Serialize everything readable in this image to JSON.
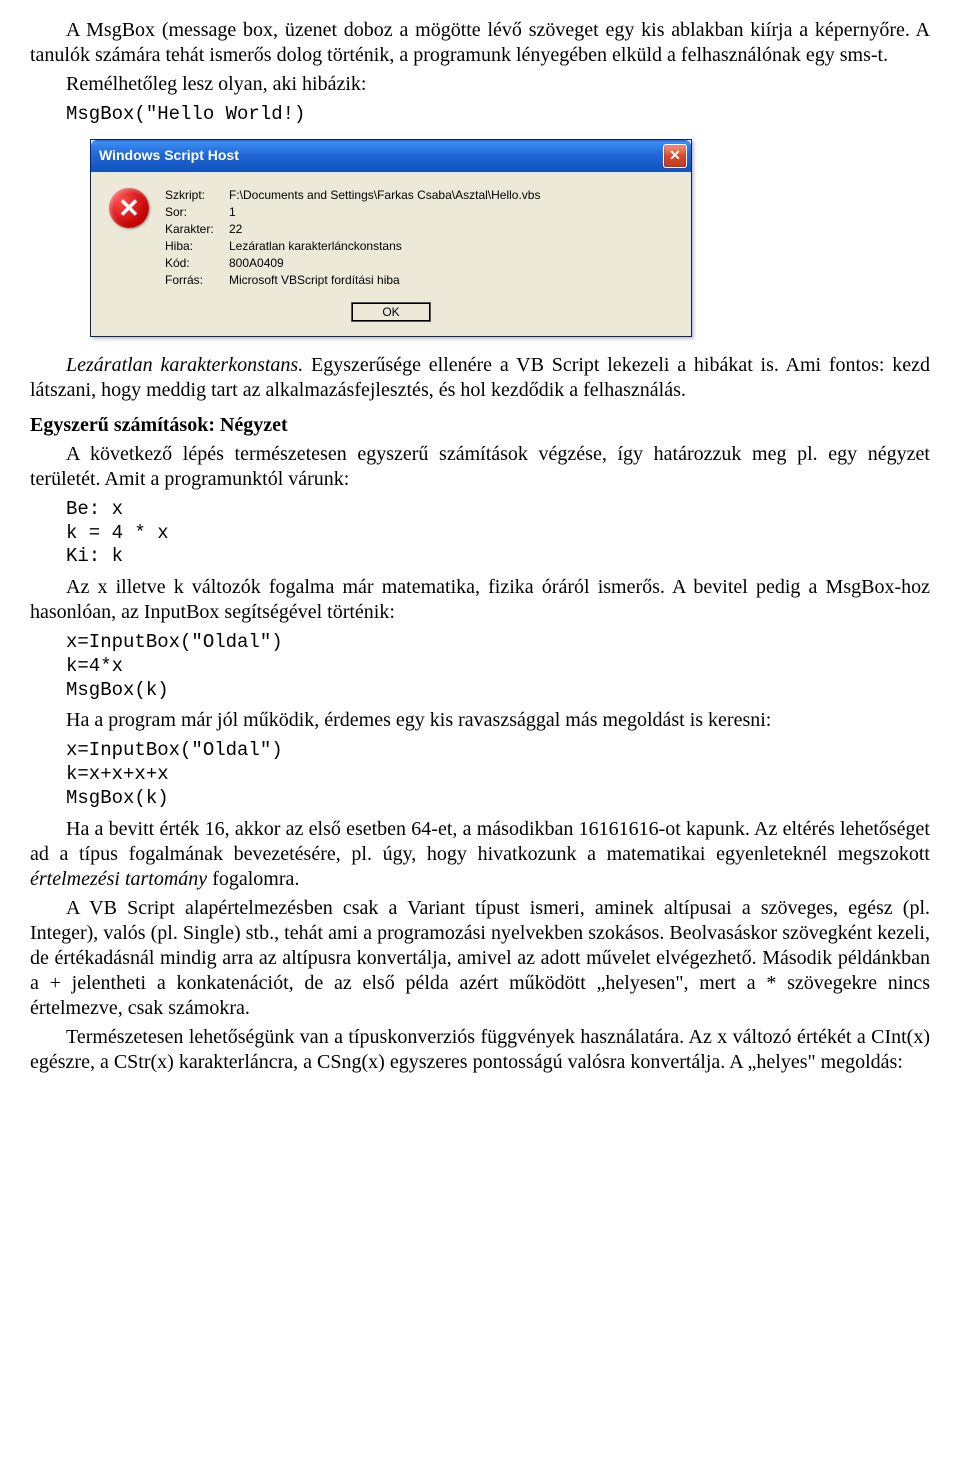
{
  "para1": "A MsgBox (message box, üzenet doboz a mögötte lévő szöveget egy kis ablakban kiírja a képernyőre. A tanulók számára tehát ismerős dolog történik, a programunk lényegében elküld a felhasználónak egy sms-t.",
  "para2": "Remélhetőleg lesz olyan, aki hibázik:",
  "code1": "MsgBox(\"Hello World!)",
  "dialog": {
    "title": "Windows Script Host",
    "close_glyph": "✕",
    "error_glyph": "✕",
    "rows": {
      "l_script": "Szkript:",
      "v_script": "F:\\Documents and Settings\\Farkas Csaba\\Asztal\\Hello.vbs",
      "l_line": "Sor:",
      "v_line": "1",
      "l_char": "Karakter:",
      "v_char": "22",
      "l_error": "Hiba:",
      "v_error": "Lezáratlan karakterlánckonstans",
      "l_code": "Kód:",
      "v_code": "800A0409",
      "l_source": "Forrás:",
      "v_source": "Microsoft VBScript fordítási hiba"
    },
    "ok": "OK"
  },
  "caption_italic": "Lezáratlan karakterkonstans.",
  "caption_rest": " Egyszerűsége ellenére a VB Script lekezeli a hibákat is. Ami fontos: kezd látszani, hogy meddig tart az alkalmazásfejlesztés, és hol kezdődik a felhasználás.",
  "heading1": "Egyszerű számítások: Négyzet",
  "para3": "A következő lépés természetesen egyszerű számítások végzése, így határozzuk meg pl. egy négyzet területét. Amit a programunktól várunk:",
  "code2": "Be: x\nk = 4 * x\nKi: k",
  "para4": "Az x illetve k változók fogalma már matematika, fizika óráról ismerős. A bevitel pedig a MsgBox-hoz hasonlóan, az InputBox segítségével történik:",
  "code3": "x=InputBox(\"Oldal\")\nk=4*x\nMsgBox(k)",
  "para5": "Ha a program már jól működik, érdemes egy kis ravaszsággal más megoldást is keresni:",
  "code4": "x=InputBox(\"Oldal\")\nk=x+x+x+x\nMsgBox(k)",
  "para6a": "Ha a bevitt érték 16, akkor az első esetben 64-et, a másodikban 16161616-ot kapunk. Az eltérés lehetőséget ad a típus fogalmának bevezetésére, pl. úgy, hogy hivatkozunk a matematikai egyenleteknél megszokott ",
  "para6_em": "értelmezési tartomány",
  "para6b": " fogalomra.",
  "para7": "A VB Script alapértelmezésben csak a Variant típust ismeri, aminek altípusai a szöveges, egész (pl. Integer), valós (pl. Single) stb., tehát ami a programozási nyelvekben szokásos. Beolvasáskor szövegként kezeli, de értékadásnál mindig arra az altípusra konvertálja, amivel az adott művelet elvégezhető. Második példánkban a + jelentheti a konkatenációt, de az első példa azért működött „helyesen\", mert a * szövegekre nincs értelmezve, csak számokra.",
  "para8": "Természetesen lehetőségünk van a típuskonverziós függvények használatára. Az x változó értékét a CInt(x) egészre, a CStr(x) karakterláncra, a CSng(x) egyszeres pontosságú valósra konvertálja. A „helyes\" megoldás:"
}
